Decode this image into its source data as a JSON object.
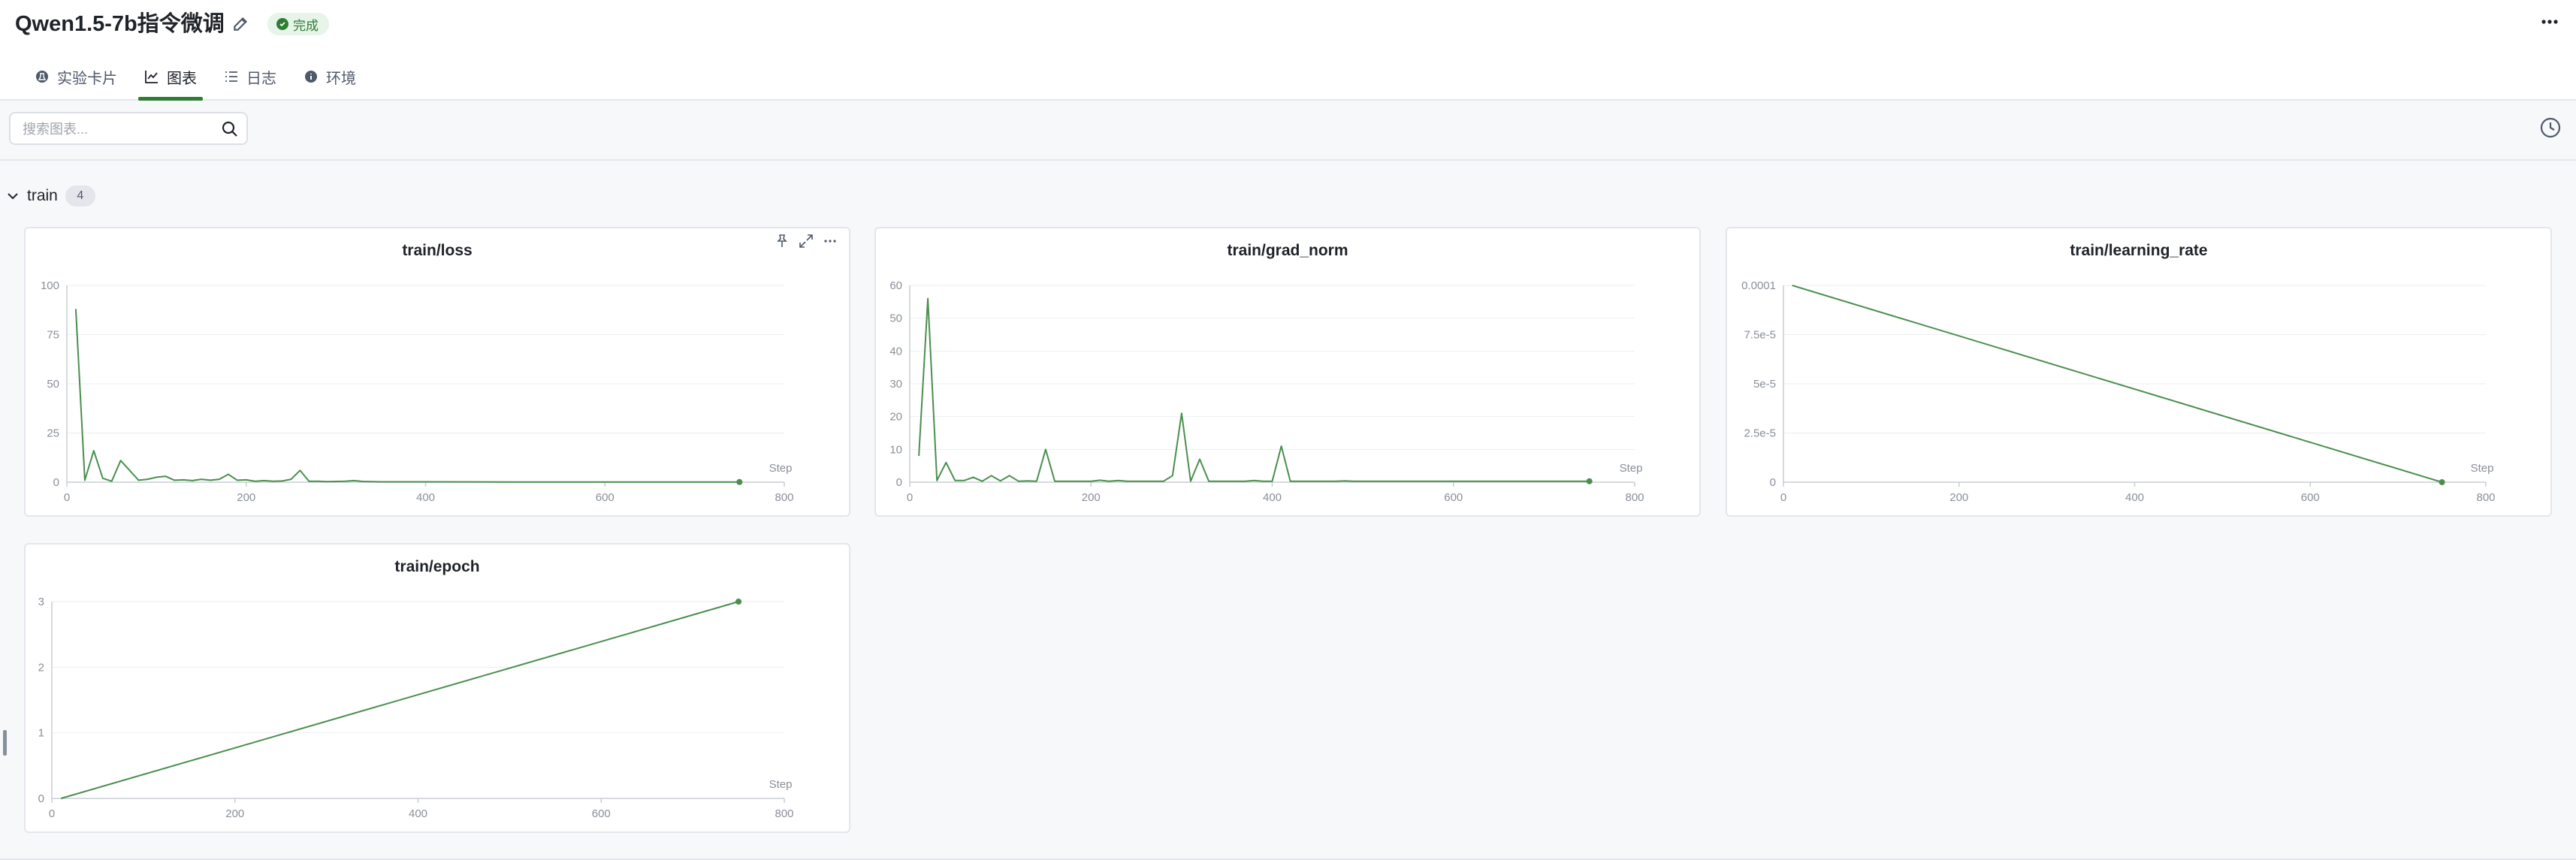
{
  "header": {
    "title": "Qwen1.5-7b指令微调",
    "status": "完成",
    "tabs": [
      {
        "label": "实验卡片",
        "icon": "experiment-icon"
      },
      {
        "label": "图表",
        "icon": "chart-icon",
        "active": true
      },
      {
        "label": "日志",
        "icon": "list-icon"
      },
      {
        "label": "环境",
        "icon": "info-icon"
      }
    ]
  },
  "toolbar": {
    "search_placeholder": "搜索图表...",
    "search_value": ""
  },
  "group": {
    "name": "train",
    "count": "4"
  },
  "colors": {
    "accent": "#2e7d32",
    "line": "#4a8f4e"
  },
  "charts": [
    {
      "title": "train/loss",
      "chart_data": {
        "type": "line",
        "title": "train/loss",
        "xlabel": "Step",
        "xlim": [
          0,
          800
        ],
        "ylim": [
          0,
          100
        ],
        "xticks": [
          "0",
          "200",
          "400",
          "600",
          "800"
        ],
        "yticks": [
          "0",
          "25",
          "50",
          "75",
          "100"
        ],
        "series": [
          {
            "x": [
              10,
              20,
              30,
              40,
              50,
              60,
              70,
              80,
              90,
              100,
              110,
              120,
              130,
              140,
              150,
              160,
              170,
              180,
              190,
              200,
              210,
              220,
              230,
              240,
              250,
              260,
              270,
              280,
              290,
              300,
              310,
              320,
              330,
              340,
              350,
              400,
              500,
              600,
              700,
              750
            ],
            "y": [
              88,
              1,
              16,
              2,
              0.5,
              11,
              6,
              1,
              1.5,
              2.5,
              3,
              1,
              1.2,
              0.8,
              1.5,
              1,
              1.5,
              4,
              1,
              1.2,
              0.5,
              0.8,
              0.5,
              0.6,
              1.5,
              6,
              0.5,
              0.5,
              0.3,
              0.4,
              0.5,
              0.8,
              0.4,
              0.3,
              0.2,
              0.2,
              0.1,
              0.1,
              0.1,
              0.1
            ]
          }
        ]
      }
    },
    {
      "title": "train/grad_norm",
      "chart_data": {
        "type": "line",
        "title": "train/grad_norm",
        "xlabel": "Step",
        "xlim": [
          0,
          800
        ],
        "ylim": [
          0,
          60
        ],
        "xticks": [
          "0",
          "200",
          "400",
          "600",
          "800"
        ],
        "yticks": [
          "0",
          "10",
          "20",
          "30",
          "40",
          "50",
          "60"
        ],
        "series": [
          {
            "x": [
              10,
              20,
              30,
              40,
              50,
              60,
              70,
              80,
              90,
              100,
              110,
              120,
              130,
              140,
              150,
              160,
              170,
              180,
              190,
              200,
              210,
              220,
              230,
              240,
              250,
              260,
              270,
              280,
              290,
              300,
              310,
              320,
              330,
              340,
              350,
              360,
              370,
              380,
              390,
              400,
              410,
              420,
              430,
              440,
              450,
              460,
              470,
              480,
              490,
              500,
              550,
              600,
              650,
              700,
              750
            ],
            "y": [
              8,
              56,
              0.5,
              6,
              0.5,
              0.5,
              1.5,
              0.3,
              2,
              0.4,
              2,
              0.3,
              0.4,
              0.3,
              10,
              0.3,
              0.3,
              0.3,
              0.3,
              0.3,
              0.6,
              0.3,
              0.5,
              0.3,
              0.3,
              0.3,
              0.3,
              0.3,
              2,
              21,
              0.3,
              7,
              0.3,
              0.3,
              0.3,
              0.3,
              0.3,
              0.5,
              0.3,
              0.3,
              11,
              0.3,
              0.3,
              0.3,
              0.3,
              0.3,
              0.3,
              0.4,
              0.3,
              0.3,
              0.3,
              0.3,
              0.3,
              0.3,
              0.3
            ]
          }
        ]
      }
    },
    {
      "title": "train/learning_rate",
      "chart_data": {
        "type": "line",
        "title": "train/learning_rate",
        "xlabel": "Step",
        "xlim": [
          0,
          800
        ],
        "ylim": [
          0,
          0.0001
        ],
        "xticks": [
          "0",
          "200",
          "400",
          "600",
          "800"
        ],
        "yticks": [
          "0",
          "2.5e-5",
          "5e-5",
          "7.5e-5",
          "0.0001"
        ],
        "series": [
          {
            "x": [
              10,
              750
            ],
            "y": [
              0.0001,
              0
            ]
          }
        ]
      }
    },
    {
      "title": "train/epoch",
      "chart_data": {
        "type": "line",
        "title": "train/epoch",
        "xlabel": "Step",
        "xlim": [
          0,
          800
        ],
        "ylim": [
          0,
          3
        ],
        "xticks": [
          "0",
          "200",
          "400",
          "600",
          "800"
        ],
        "yticks": [
          "0",
          "1",
          "2",
          "3"
        ],
        "series": [
          {
            "x": [
              10,
              750
            ],
            "y": [
              0,
              3
            ]
          }
        ]
      }
    }
  ]
}
